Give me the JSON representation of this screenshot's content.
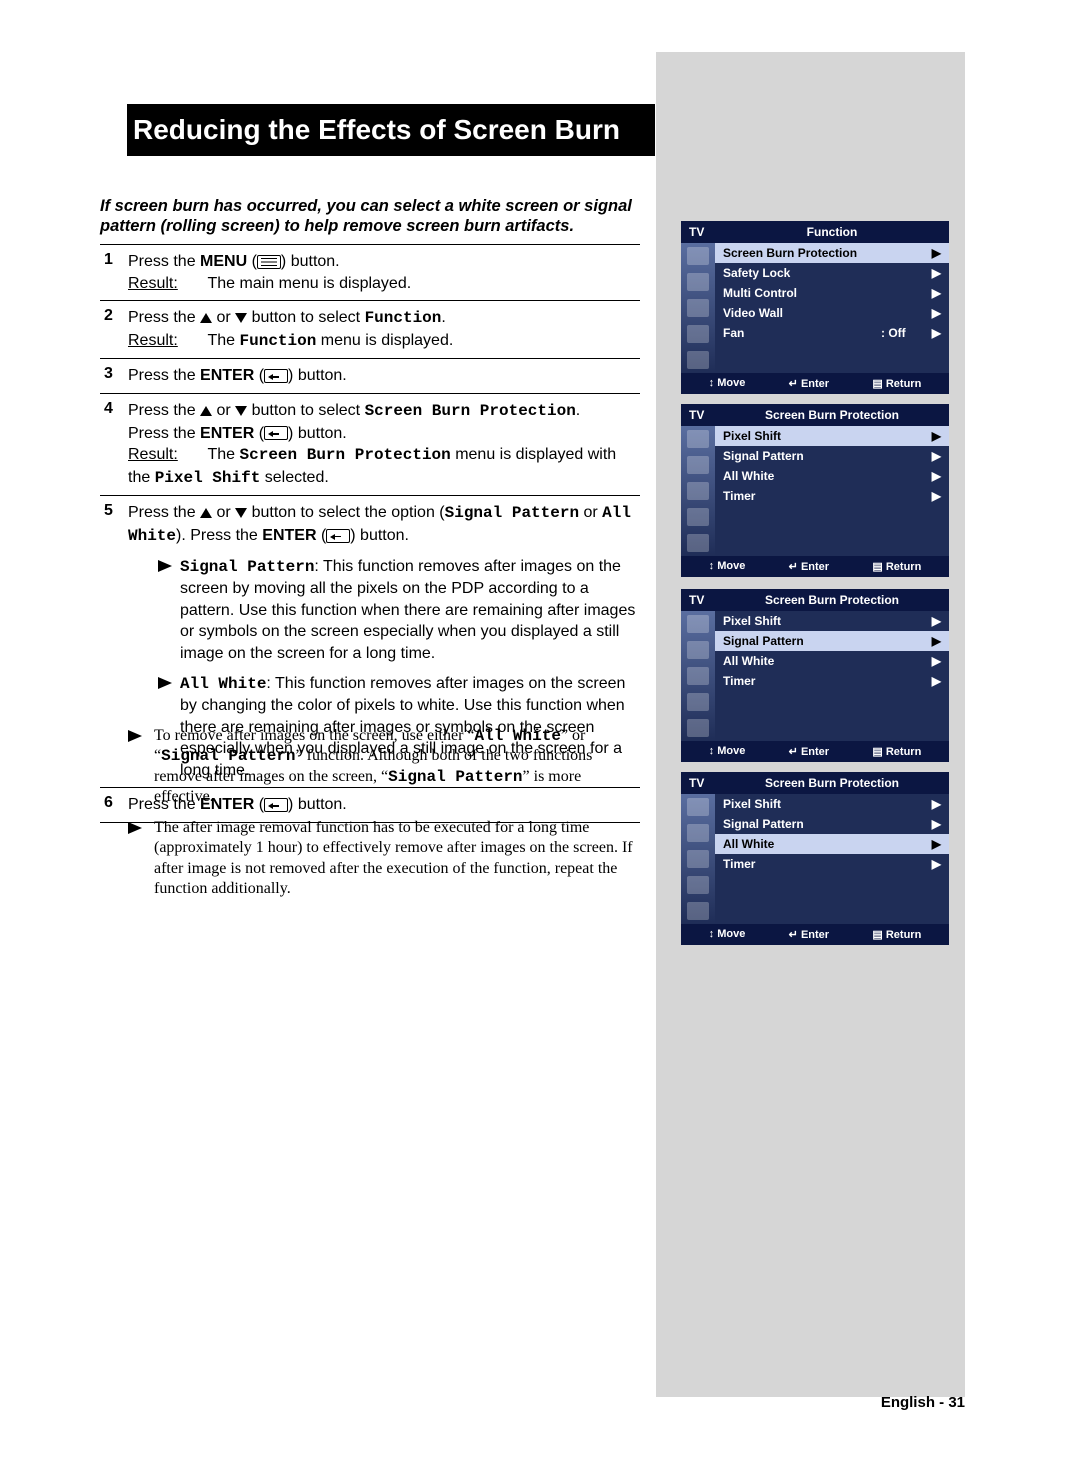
{
  "title": "Reducing the Effects of Screen Burn",
  "intro": "If screen burn has occurred, you can select a white screen or signal pattern (rolling screen) to help remove screen burn artifacts.",
  "result_label": "Result:",
  "steps": {
    "s1": {
      "num": "1",
      "a": "Press the ",
      "menu": "MENU",
      "b": " button.",
      "res": "The main menu is displayed."
    },
    "s2": {
      "num": "2",
      "a": "Press the ",
      "b": " button to select ",
      "fn": "Function",
      "c": ".",
      "res_a": "The ",
      "res_b": " menu is displayed."
    },
    "s3": {
      "num": "3",
      "a": "Press the ",
      "enter": "ENTER",
      "b": " button."
    },
    "s4": {
      "num": "4",
      "a": "Press the ",
      "b": " button to select ",
      "sbp": "Screen Burn Protection",
      "c": ".",
      "d": "Press the ",
      "e": " button.",
      "res_a": "The ",
      "res_b": " menu is displayed with the ",
      "px": "Pixel Shift",
      "res_c": " selected."
    },
    "s5": {
      "num": "5",
      "a": "Press the ",
      "b": " button to select the option (",
      "sp": "Signal Pattern",
      "or": " or ",
      "aw": "All White",
      "c2": "). Press the ",
      "d": " button.",
      "sp_title": "Signal Pattern",
      "sp_text": ": This function removes after images on the screen by moving all the pixels on the PDP according to a pattern. Use this function when there are remaining after images or symbols on the screen especially when you displayed a still image on the screen for a long time.",
      "aw_title": "All White",
      "aw_text": ": This function removes after images on the screen by changing the color of pixels to white. Use this function when there are remaining after images or symbols on the screen especially when you displayed a still image on the screen for a long time."
    },
    "s6": {
      "num": "6",
      "a": "Press the ",
      "enter": "ENTER",
      "b": " button."
    }
  },
  "notes": {
    "n1_a": "To remove after images on the screen, use either “",
    "n1_aw": "All White",
    "n1_b": "” or “",
    "n1_sp": "Signal Pattern",
    "n1_c": "” function. Although both of the two functions remove after images on the screen, “",
    "n1_d": "” is more effective.",
    "n2": "The after image removal function has to be executed for a long time (approximately 1 hour) to effectively remove after images on the screen. If after image is not removed after the execution of the function, repeat the function additionally."
  },
  "osd": {
    "tv": "TV",
    "footer": {
      "move": "Move",
      "enter": "Enter",
      "return": "Return"
    },
    "menu1": {
      "title": "Function",
      "items": [
        {
          "label": "Screen Burn Protection",
          "sel": true
        },
        {
          "label": "Safety Lock"
        },
        {
          "label": "Multi Control"
        },
        {
          "label": "Video Wall"
        },
        {
          "label": "Fan",
          "val": ": Off"
        }
      ]
    },
    "menu2": {
      "title": "Screen Burn Protection",
      "items": [
        {
          "label": "Pixel Shift",
          "sel": true
        },
        {
          "label": "Signal Pattern"
        },
        {
          "label": "All White"
        },
        {
          "label": "Timer"
        }
      ]
    },
    "menu3": {
      "title": "Screen Burn Protection",
      "items": [
        {
          "label": "Pixel Shift"
        },
        {
          "label": "Signal Pattern",
          "sel": true
        },
        {
          "label": "All White"
        },
        {
          "label": "Timer"
        }
      ]
    },
    "menu4": {
      "title": "Screen Burn Protection",
      "items": [
        {
          "label": "Pixel Shift"
        },
        {
          "label": "Signal Pattern"
        },
        {
          "label": "All White",
          "sel": true
        },
        {
          "label": "Timer"
        }
      ]
    }
  },
  "footer": "English - 31"
}
